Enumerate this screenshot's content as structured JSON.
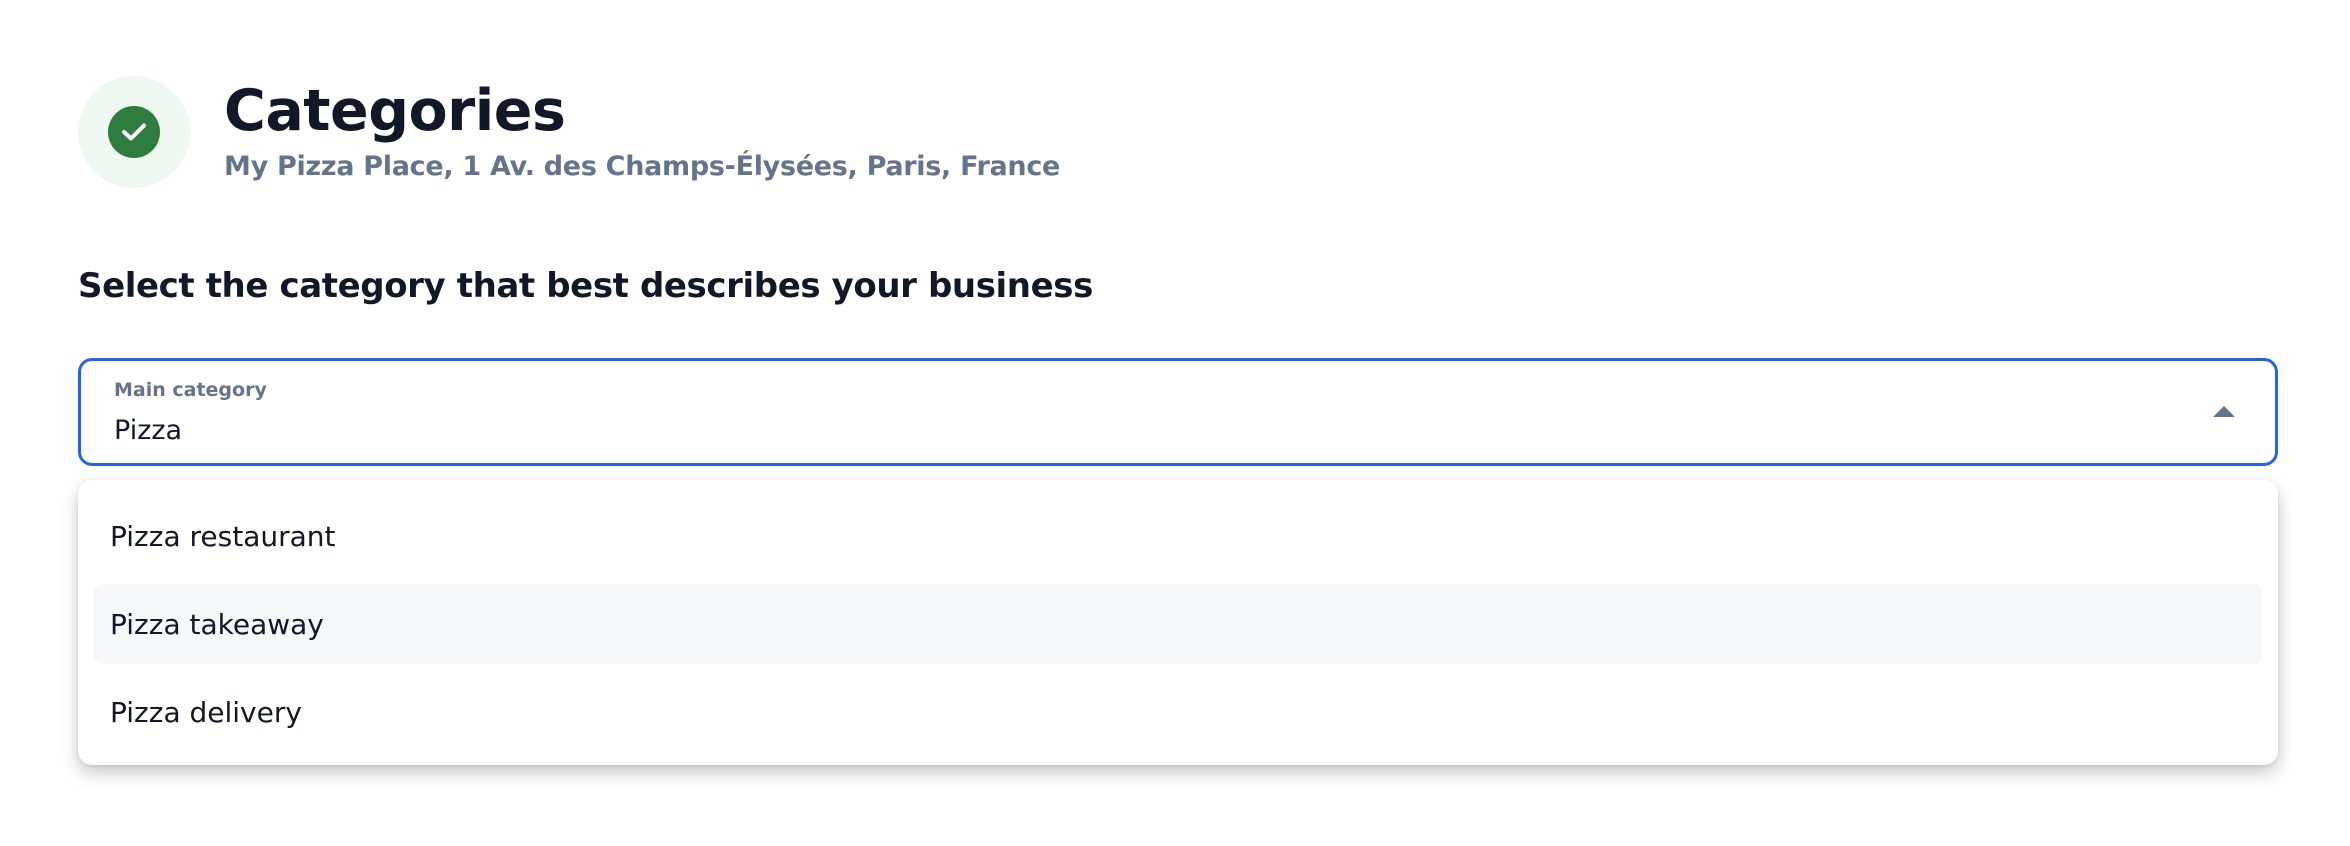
{
  "header": {
    "title": "Categories",
    "subtitle": "My Pizza Place, 1 Av. des Champs-Élysées, Paris, France",
    "status_icon": "check-circle-icon",
    "status_color": "#2e7d3e"
  },
  "section": {
    "heading": "Select the category that best describes your business"
  },
  "main_category": {
    "label": "Main category",
    "value": "Pizza",
    "state": "open",
    "accent_color": "#2563eb"
  },
  "dropdown": {
    "options": [
      {
        "label": "Pizza restaurant",
        "highlighted": false
      },
      {
        "label": "Pizza takeaway",
        "highlighted": true
      },
      {
        "label": "Pizza delivery",
        "highlighted": false
      }
    ]
  }
}
